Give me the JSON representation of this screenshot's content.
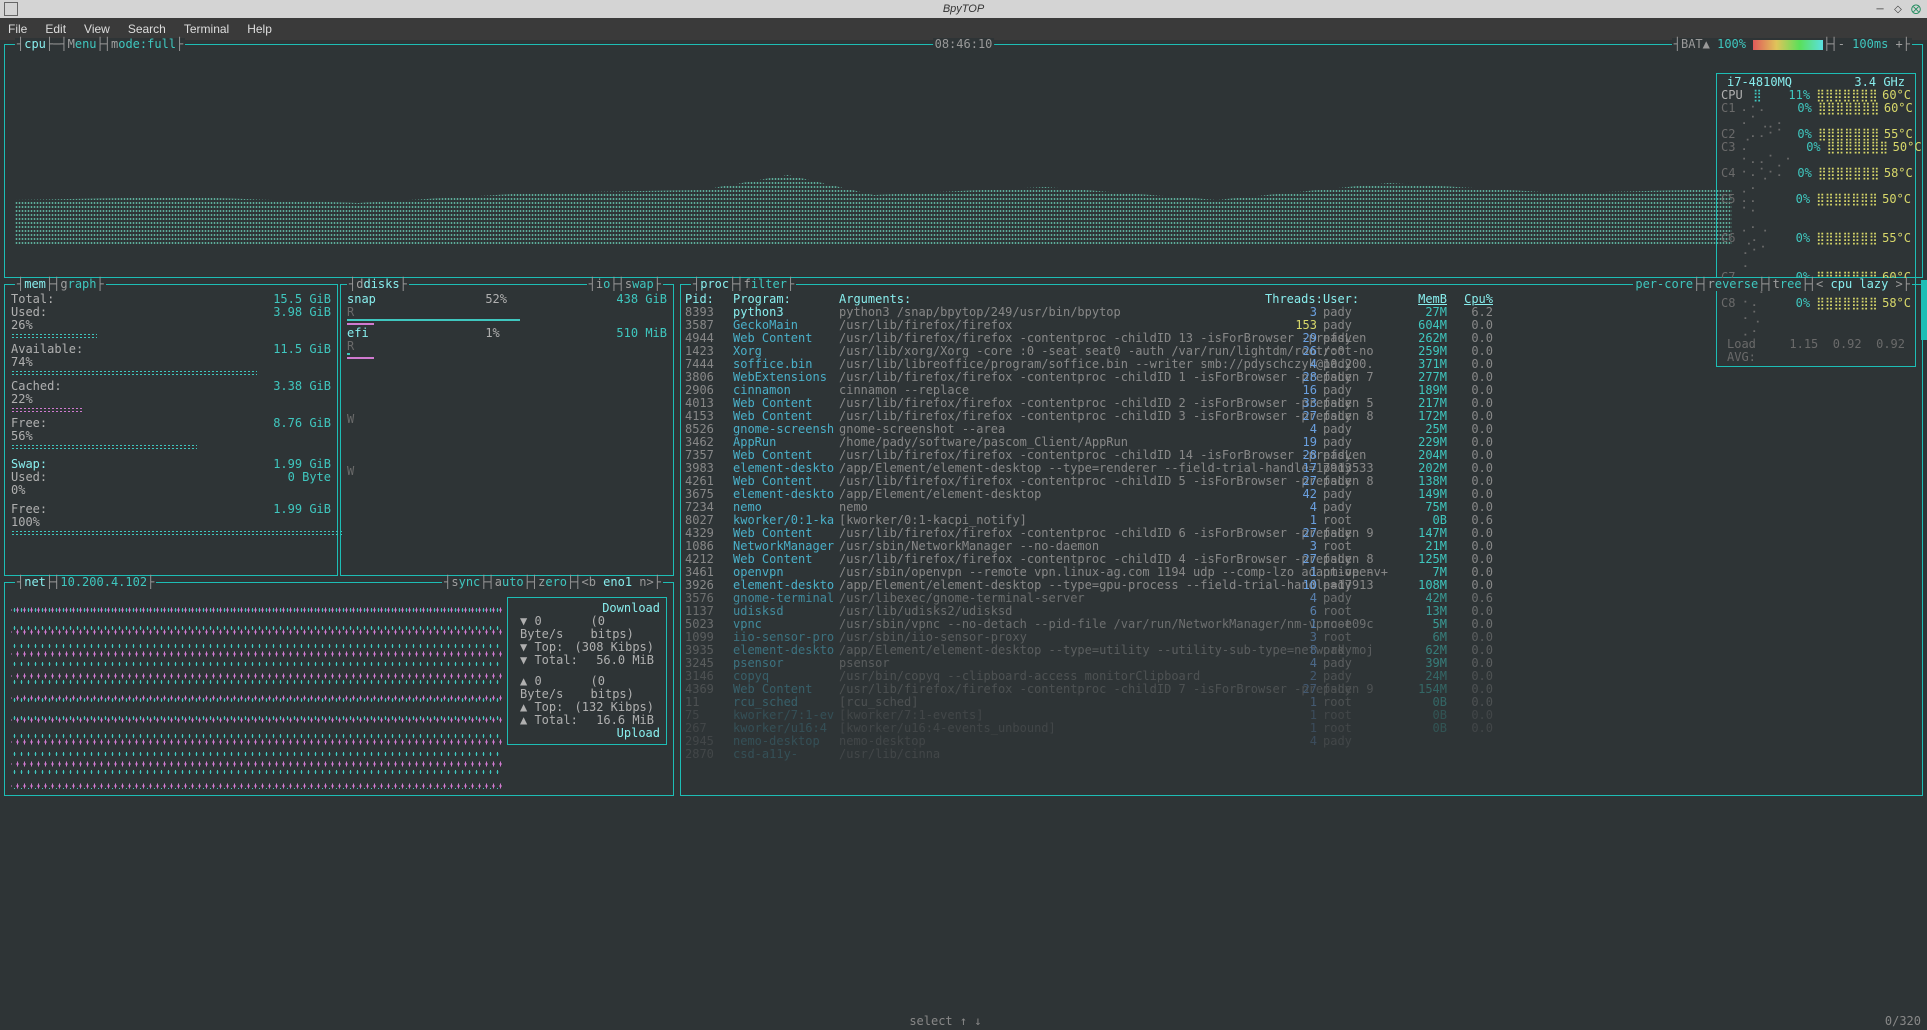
{
  "window": {
    "title": "BpyTOP"
  },
  "menubar": [
    "File",
    "Edit",
    "View",
    "Search",
    "Terminal",
    "Help"
  ],
  "topbar": {
    "cpu_label": "cpu",
    "menu_label": "enu",
    "mode_label": "ode:full",
    "menu_key": "M",
    "mode_key": "m",
    "clock": "08:46:10",
    "bat_label": "BAT▲",
    "bat_pct": "100%",
    "update_label": "100ms",
    "plus_key": "+",
    "minus_key": "-"
  },
  "cpu": {
    "name": "i7-4810MQ",
    "freq": "3.4 GHz",
    "overall": {
      "label": "CPU",
      "pct": "11%",
      "temp": "60°C",
      "bar": "⣿"
    },
    "cores": [
      {
        "label": "C1",
        "pct": "0%",
        "temp": "60°C",
        "bar": "⠄⠂⠄ ⠄⠁⢀⡀⠄"
      },
      {
        "label": "C2",
        "pct": "0%",
        "temp": "55°C",
        "bar": "⢀⠄⠄⠂⠁"
      },
      {
        "label": "C3",
        "pct": "0%",
        "temp": "50°C",
        "bar": "⠄ ⠂⠄⠄⠁⡀⠂"
      },
      {
        "label": "C4",
        "pct": "0%",
        "temp": "58°C",
        "bar": "⠂⠄⢁⠂⠄ ⡀⠄"
      },
      {
        "label": "C5",
        "pct": "0%",
        "temp": "50°C",
        "bar": "⠄⠄ ⠁⠂ ⡀⠄⢀"
      },
      {
        "label": "C6",
        "pct": "0%",
        "temp": "55°C",
        "bar": "⢀⠄ ⠄⠂⠁ ⠄"
      },
      {
        "label": "C7",
        "pct": "0%",
        "temp": "60°C",
        "bar": "⠄⢀⠄ ⠂ ⠄⠁"
      },
      {
        "label": "C8",
        "pct": "0%",
        "temp": "58°C",
        "bar": "⠂⠄ ⠄⢁ ⡀⠄"
      }
    ],
    "loadavg": {
      "label": "Load AVG:",
      "v1": "1.15",
      "v2": "0.92",
      "v3": "0.92"
    }
  },
  "mem": {
    "box_label": "mem",
    "graph_key": "g",
    "graph_label": "raph",
    "total": {
      "label": "Total:",
      "val": "15.5 GiB"
    },
    "used": {
      "label": "Used:",
      "val": "3.98 GiB",
      "pct": "26%"
    },
    "avail": {
      "label": "Available:",
      "val": "11.5 GiB",
      "pct": "74%"
    },
    "cached": {
      "label": "Cached:",
      "val": "3.38 GiB",
      "pct": "22%"
    },
    "free": {
      "label": "Free:",
      "val": "8.76 GiB",
      "pct": "56%"
    },
    "swap": {
      "label": "Swap:",
      "val": "1.99 GiB"
    },
    "swap_used": {
      "label": "Used:",
      "val": "0 Byte",
      "pct": "0%"
    },
    "swap_free": {
      "label": "Free:",
      "val": "1.99 GiB",
      "pct": "100%"
    }
  },
  "disks": {
    "box_label": "disks",
    "io_key": "i",
    "io_label": "o",
    "swap_key": "s",
    "swap_label": "wap",
    "disks_key": "d",
    "items": [
      {
        "name": "snap",
        "pct": "52%",
        "size": "438 GiB",
        "rw": "R"
      },
      {
        "name": "efi",
        "pct": "1%",
        "size": "510 MiB",
        "rw": "R",
        "rw2": "W"
      }
    ],
    "tailW": "W"
  },
  "net": {
    "box_label": "net",
    "ip": "10.200.4.102",
    "sync_key": "s",
    "sync_label": "ync",
    "auto_key": "a",
    "auto_label": "uto",
    "zero_key": "z",
    "zero_label": "ero",
    "iface_pre": "<b ",
    "iface": "eno1",
    "iface_post": " n>",
    "dl": {
      "title": "Download",
      "rate": "0 Byte/s",
      "bits": "(0 bitps)",
      "top_label": "Top:",
      "top": "(308 Kibps)",
      "total_label": "Total:",
      "total": "56.0 MiB"
    },
    "ul": {
      "title": "Upload",
      "rate": "0 Byte/s",
      "bits": "(0 bitps)",
      "top_label": "Top:",
      "top": "(132 Kibps)",
      "total_label": "Total:",
      "total": "16.6 MiB"
    }
  },
  "proc": {
    "box_label": "proc",
    "filter_key": "f",
    "filter_label": "ilter",
    "percore": "per-core",
    "reverse_key": "r",
    "reverse_label": "everse",
    "tree_key": "t",
    "tree_label": "ree",
    "sort_left": "<",
    "sort": "cpu lazy",
    "sort_right": ">",
    "head": {
      "pid": "Pid:",
      "program": "Program:",
      "args": "Arguments:",
      "threads": "Threads:",
      "user": "User:",
      "memb": "MemB",
      "cpu": "Cpu%"
    },
    "rows": [
      {
        "pid": "8393",
        "prog": "python3",
        "args": "python3 /snap/bpytop/249/usr/bin/bpytop",
        "thr": "3",
        "user": "pady",
        "mem": "27M",
        "cpu": "6.2",
        "hl": 1
      },
      {
        "pid": "3587",
        "prog": "GeckoMain",
        "args": "/usr/lib/firefox/firefox",
        "thr": "153",
        "user": "pady",
        "mem": "604M",
        "cpu": "0.0"
      },
      {
        "pid": "4944",
        "prog": "Web Content",
        "args": "/usr/lib/firefox/firefox -contentproc -childID 13 -isForBrowser -prefsLen",
        "thr": "29",
        "user": "pady",
        "mem": "262M",
        "cpu": "0.0"
      },
      {
        "pid": "1423",
        "prog": "Xorg",
        "args": "/usr/lib/xorg/Xorg -core :0 -seat seat0 -auth /var/run/lightdm/root/:0 -no",
        "thr": "26",
        "user": "root",
        "mem": "259M",
        "cpu": "0.0"
      },
      {
        "pid": "7444",
        "prog": "soffice.bin",
        "args": "/usr/lib/libreoffice/program/soffice.bin --writer smb://pdyschczyk@10.200.",
        "thr": "4",
        "user": "pady",
        "mem": "371M",
        "cpu": "0.0"
      },
      {
        "pid": "3806",
        "prog": "WebExtensions",
        "args": "/usr/lib/firefox/firefox -contentproc -childID 1 -isForBrowser -prefsLen 7",
        "thr": "28",
        "user": "pady",
        "mem": "277M",
        "cpu": "0.0"
      },
      {
        "pid": "2906",
        "prog": "cinnamon",
        "args": "cinnamon --replace",
        "thr": "16",
        "user": "pady",
        "mem": "189M",
        "cpu": "0.0"
      },
      {
        "pid": "4013",
        "prog": "Web Content",
        "args": "/usr/lib/firefox/firefox -contentproc -childID 2 -isForBrowser -prefsLen 5",
        "thr": "33",
        "user": "pady",
        "mem": "217M",
        "cpu": "0.0"
      },
      {
        "pid": "4153",
        "prog": "Web Content",
        "args": "/usr/lib/firefox/firefox -contentproc -childID 3 -isForBrowser -prefsLen 8",
        "thr": "27",
        "user": "pady",
        "mem": "172M",
        "cpu": "0.0"
      },
      {
        "pid": "8526",
        "prog": "gnome-screensh",
        "args": "gnome-screenshot --area",
        "thr": "4",
        "user": "pady",
        "mem": "25M",
        "cpu": "0.0"
      },
      {
        "pid": "3462",
        "prog": "AppRun",
        "args": "/home/pady/software/pascom_Client/AppRun",
        "thr": "19",
        "user": "pady",
        "mem": "229M",
        "cpu": "0.0"
      },
      {
        "pid": "7357",
        "prog": "Web Content",
        "args": "/usr/lib/firefox/firefox -contentproc -childID 14 -isForBrowser -prefsLen",
        "thr": "28",
        "user": "pady",
        "mem": "204M",
        "cpu": "0.0"
      },
      {
        "pid": "3983",
        "prog": "element-deskto",
        "args": "/app/Element/element-desktop --type=renderer --field-trial-handle=17913533",
        "thr": "17",
        "user": "pady",
        "mem": "202M",
        "cpu": "0.0"
      },
      {
        "pid": "4261",
        "prog": "Web Content",
        "args": "/usr/lib/firefox/firefox -contentproc -childID 5 -isForBrowser -prefsLen 8",
        "thr": "27",
        "user": "pady",
        "mem": "138M",
        "cpu": "0.0"
      },
      {
        "pid": "3675",
        "prog": "element-deskto",
        "args": "/app/Element/element-desktop",
        "thr": "42",
        "user": "pady",
        "mem": "149M",
        "cpu": "0.0"
      },
      {
        "pid": "7234",
        "prog": "nemo",
        "args": "nemo",
        "thr": "4",
        "user": "pady",
        "mem": "75M",
        "cpu": "0.0"
      },
      {
        "pid": "8027",
        "prog": "kworker/0:1-ka",
        "args": "[kworker/0:1-kacpi_notify]",
        "thr": "1",
        "user": "root",
        "mem": "0B",
        "cpu": "0.6"
      },
      {
        "pid": "4329",
        "prog": "Web Content",
        "args": "/usr/lib/firefox/firefox -contentproc -childID 6 -isForBrowser -prefsLen 9",
        "thr": "27",
        "user": "pady",
        "mem": "147M",
        "cpu": "0.0"
      },
      {
        "pid": "1086",
        "prog": "NetworkManager",
        "args": "/usr/sbin/NetworkManager --no-daemon",
        "thr": "3",
        "user": "root",
        "mem": "21M",
        "cpu": "0.0"
      },
      {
        "pid": "4212",
        "prog": "Web Content",
        "args": "/usr/lib/firefox/firefox -contentproc -childID 4 -isForBrowser -prefsLen 8",
        "thr": "27",
        "user": "pady",
        "mem": "125M",
        "cpu": "0.0"
      },
      {
        "pid": "3461",
        "prog": "openvpn",
        "args": "/usr/sbin/openvpn --remote vpn.linux-ag.com 1194 udp --comp-lzo adaptive -",
        "thr": "1",
        "user": "nm-openv+",
        "mem": "7M",
        "cpu": "0.0"
      },
      {
        "pid": "3926",
        "prog": "element-deskto",
        "args": "/app/Element/element-desktop --type=gpu-process --field-trial-handle=17913",
        "thr": "10",
        "user": "pady",
        "mem": "108M",
        "cpu": "0.0"
      },
      {
        "pid": "3576",
        "prog": "gnome-terminal",
        "args": "/usr/libexec/gnome-terminal-server",
        "thr": "4",
        "user": "pady",
        "mem": "42M",
        "cpu": "0.6",
        "f": 1
      },
      {
        "pid": "1137",
        "prog": "udisksd",
        "args": "/usr/lib/udisks2/udisksd",
        "thr": "6",
        "user": "root",
        "mem": "13M",
        "cpu": "0.0",
        "f": 1
      },
      {
        "pid": "5023",
        "prog": "vpnc",
        "args": "/usr/sbin/vpnc --no-detach --pid-file /var/run/NetworkManager/nm-vpnc-e09c",
        "thr": "1",
        "user": "root",
        "mem": "5M",
        "cpu": "0.0",
        "f": 1
      },
      {
        "pid": "1099",
        "prog": "iio-sensor-pro",
        "args": "/usr/sbin/iio-sensor-proxy",
        "thr": "3",
        "user": "root",
        "mem": "6M",
        "cpu": "0.0",
        "f": 2
      },
      {
        "pid": "3935",
        "prog": "element-deskto",
        "args": "/app/Element/element-desktop --type=utility --utility-sub-type=network.moj",
        "thr": "8",
        "user": "pady",
        "mem": "62M",
        "cpu": "0.0",
        "f": 2
      },
      {
        "pid": "3245",
        "prog": "psensor",
        "args": "psensor",
        "thr": "4",
        "user": "pady",
        "mem": "39M",
        "cpu": "0.0",
        "f": 2
      },
      {
        "pid": "3146",
        "prog": "copyq",
        "args": "/usr/bin/copyq --clipboard-access monitorClipboard",
        "thr": "2",
        "user": "pady",
        "mem": "24M",
        "cpu": "0.0",
        "f": 3
      },
      {
        "pid": "4369",
        "prog": "Web Content",
        "args": "/usr/lib/firefox/firefox -contentproc -childID 7 -isForBrowser -prefsLen 9",
        "thr": "27",
        "user": "pady",
        "mem": "154M",
        "cpu": "0.0",
        "f": 3
      },
      {
        "pid": "11",
        "prog": "rcu_sched",
        "args": "[rcu_sched]",
        "thr": "1",
        "user": "root",
        "mem": "0B",
        "cpu": "0.0",
        "f": 3
      },
      {
        "pid": "75",
        "prog": "kworker/7:1-ev",
        "args": "[kworker/7:1-events]",
        "thr": "1",
        "user": "root",
        "mem": "0B",
        "cpu": "0.0",
        "f": 4
      },
      {
        "pid": "267",
        "prog": "kworker/u16:4",
        "args": "[kworker/u16:4-events_unbound]",
        "thr": "1",
        "user": "root",
        "mem": "0B",
        "cpu": "0.0",
        "f": 4
      },
      {
        "pid": "2945",
        "prog": "nemo-desktop",
        "args": "nemo-desktop",
        "thr": "4",
        "user": "pady",
        "mem": "",
        "cpu": "",
        "f": 4
      },
      {
        "pid": "2870",
        "prog": "csd-a11y-",
        "args": "/usr/lib/cinna",
        "thr": "",
        "user": "",
        "mem": "",
        "cpu": "",
        "f": 4
      }
    ]
  },
  "footer": {
    "select": "select ↑ ↓",
    "pos": "0/320"
  }
}
